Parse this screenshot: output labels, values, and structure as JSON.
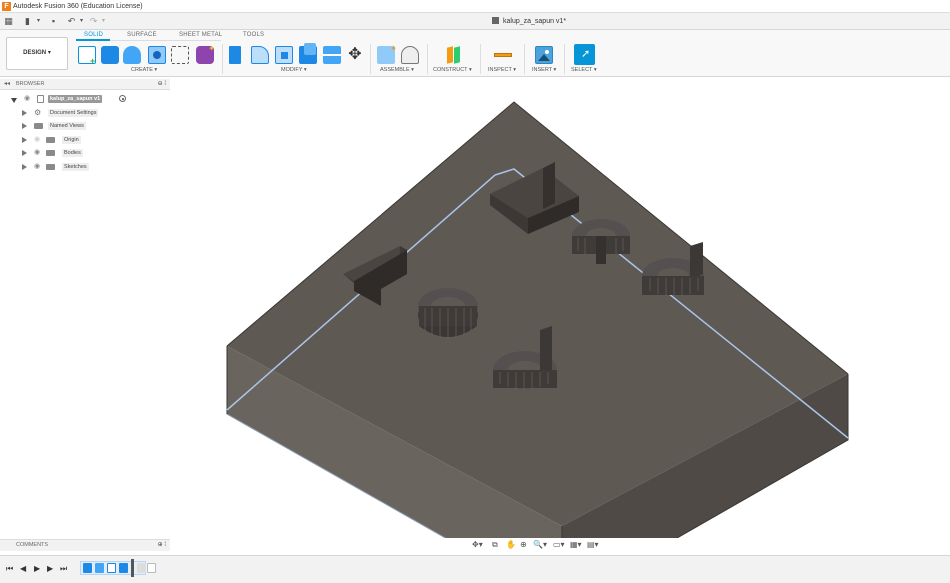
{
  "window": {
    "title": "Autodesk Fusion 360 (Education License)",
    "logo": "F"
  },
  "document": {
    "name": "kalup_za_sapun v1*"
  },
  "quick_access": {
    "icons": [
      "grid-icon",
      "file-icon",
      "save-icon",
      "undo-icon",
      "redo-icon"
    ]
  },
  "toolbar": {
    "workspace_label": "DESIGN",
    "tabs": [
      {
        "label": "SOLID"
      },
      {
        "label": "SURFACE"
      },
      {
        "label": "SHEET METAL"
      },
      {
        "label": "TOOLS"
      }
    ],
    "groups": {
      "create": "CREATE",
      "modify": "MODIFY",
      "assemble": "ASSEMBLE",
      "construct": "CONSTRUCT",
      "inspect": "INSPECT",
      "insert": "INSERT",
      "select": "SELECT"
    },
    "accent": "#0696d7"
  },
  "browser": {
    "title": "BROWSER",
    "root": "kalup_za_sapun v1",
    "items": [
      {
        "label": "Document Settings"
      },
      {
        "label": "Named Views"
      },
      {
        "label": "Origin"
      },
      {
        "label": "Bodies"
      },
      {
        "label": "Sketches"
      }
    ]
  },
  "comments": {
    "title": "COMMENTS"
  },
  "colors": {
    "body_top": "#5f5954",
    "body_left": "#6a645e",
    "body_right": "#4f4a46",
    "edge_highlight": "#a9c6ea"
  }
}
